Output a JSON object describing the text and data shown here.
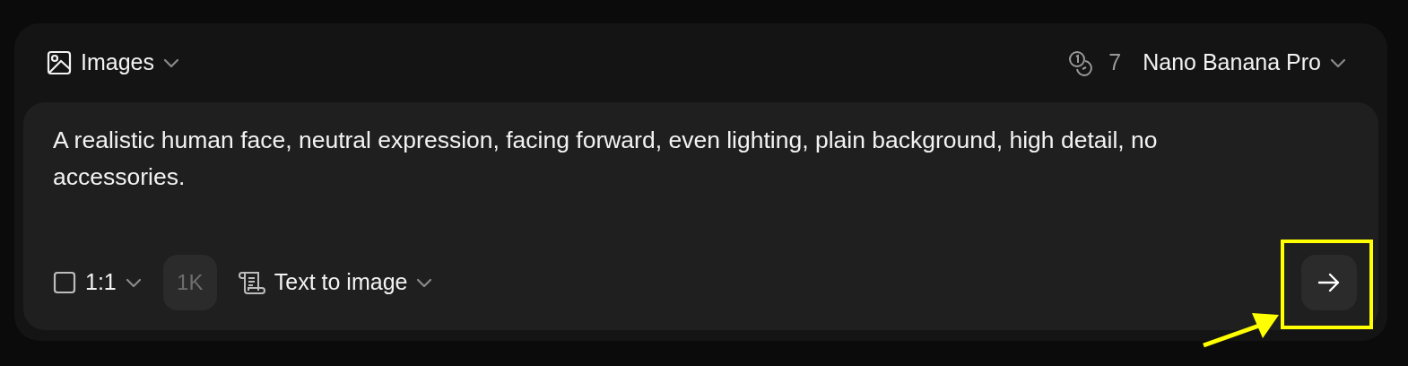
{
  "mode_selector": {
    "label": "Images"
  },
  "credits": {
    "count": "7"
  },
  "model_selector": {
    "label": "Nano Banana Pro"
  },
  "prompt": {
    "value": "A realistic human face, neutral expression, facing forward, even lighting, plain background, high detail, no accessories."
  },
  "aspect_ratio": {
    "label": "1:1"
  },
  "resolution": {
    "label": "1K",
    "disabled": true
  },
  "generation_mode": {
    "label": "Text to image"
  }
}
